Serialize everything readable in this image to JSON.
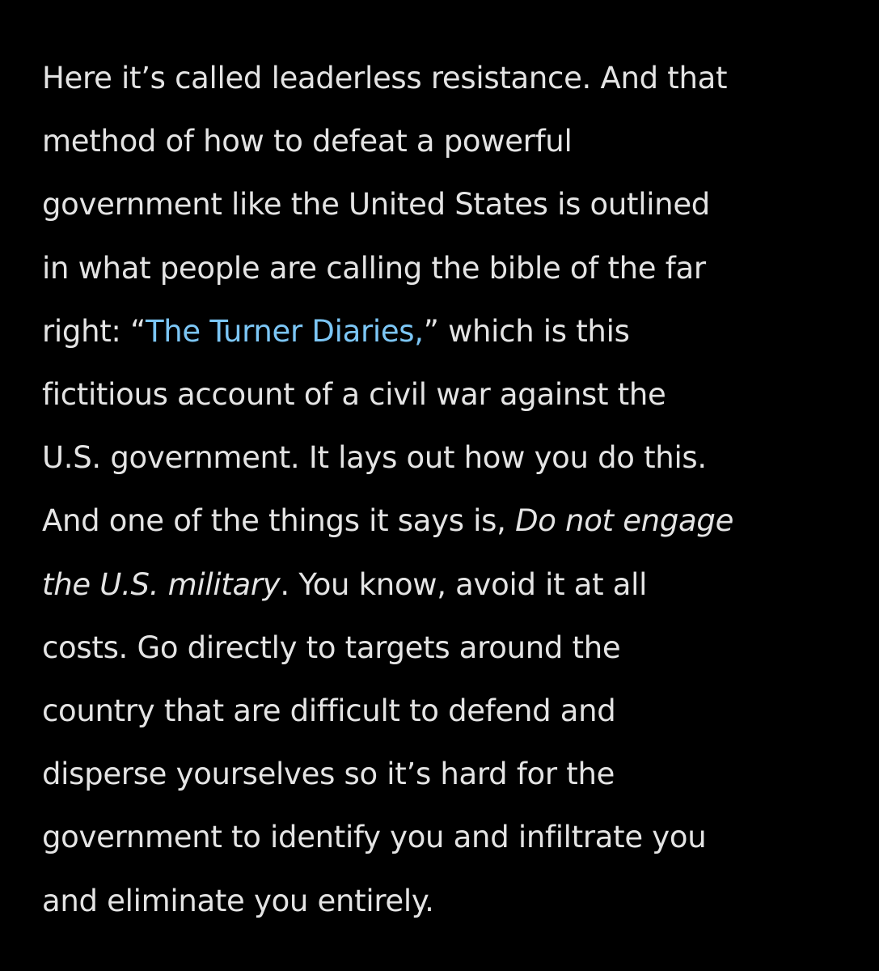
{
  "colors": {
    "background": "#000000",
    "text": "#e4e4e4",
    "link": "#7cc6f5"
  },
  "article": {
    "lines": [
      "Here it’s called leaderless resistance. And that",
      "method of how to defeat a powerful",
      "government like the United States is outlined",
      "in what people are calling the bible of the far",
      {
        "before": "right: “",
        "link": "The Turner Diaries,",
        "after": "” which is this"
      },
      "fictitious account of a civil war against the",
      "U.S. government. It lays out how you do this.",
      {
        "before": "And one of the things it says is, ",
        "em": "Do not engage"
      },
      {
        "em": "the U.S. military",
        "after": ". You know, avoid it at all"
      },
      "costs. Go directly to targets around the",
      "country that are difficult to defend and",
      "disperse yourselves so it’s hard for the",
      "government to identify you and infiltrate you",
      "and eliminate you entirely."
    ]
  }
}
